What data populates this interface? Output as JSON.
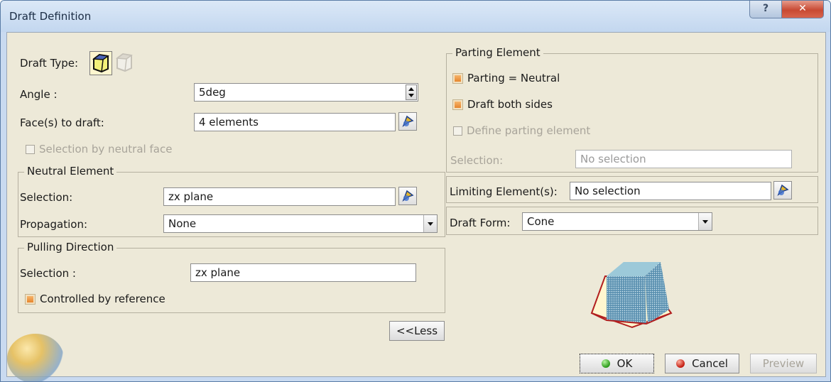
{
  "window": {
    "title": "Draft Definition"
  },
  "left": {
    "draft_type_label": "Draft Type:",
    "angle_label": "Angle :",
    "angle_value": "5deg",
    "faces_label": "Face(s) to draft:",
    "faces_value": "4 elements",
    "selection_by_neutral_face": "Selection by neutral face",
    "neutral_element": {
      "title": "Neutral Element",
      "selection_label": "Selection:",
      "selection_value": "zx plane",
      "propagation_label": "Propagation:",
      "propagation_value": "None"
    },
    "pulling_direction": {
      "title": "Pulling Direction",
      "selection_label": "Selection :",
      "selection_value": "zx plane",
      "controlled_by_reference": "Controlled by reference"
    },
    "less_button": "<<Less"
  },
  "right": {
    "parting_element": {
      "title": "Parting Element",
      "parting_neutral": "Parting = Neutral",
      "draft_both_sides": "Draft both sides",
      "define_parting_element": "Define parting element",
      "selection_label": "Selection:",
      "selection_value": "No selection"
    },
    "limiting_label": "Limiting Element(s):",
    "limiting_value": "No selection",
    "draft_form_label": "Draft Form:",
    "draft_form_value": "Cone"
  },
  "footer": {
    "ok": "OK",
    "cancel": "Cancel",
    "preview": "Preview"
  },
  "states": {
    "parting_neutral": true,
    "draft_both_sides": true,
    "controlled_by_reference": true,
    "selection_by_neutral_face": false,
    "define_parting_element": false
  },
  "icons": [
    "help-icon",
    "close-icon",
    "draft-type-cube-icon",
    "draft-type-ghost-icon",
    "spin-up-icon",
    "spin-down-icon",
    "selection-picker-icon",
    "dropdown-arrow-icon",
    "draft-preview-icon",
    "status-green-icon",
    "status-red-icon"
  ]
}
